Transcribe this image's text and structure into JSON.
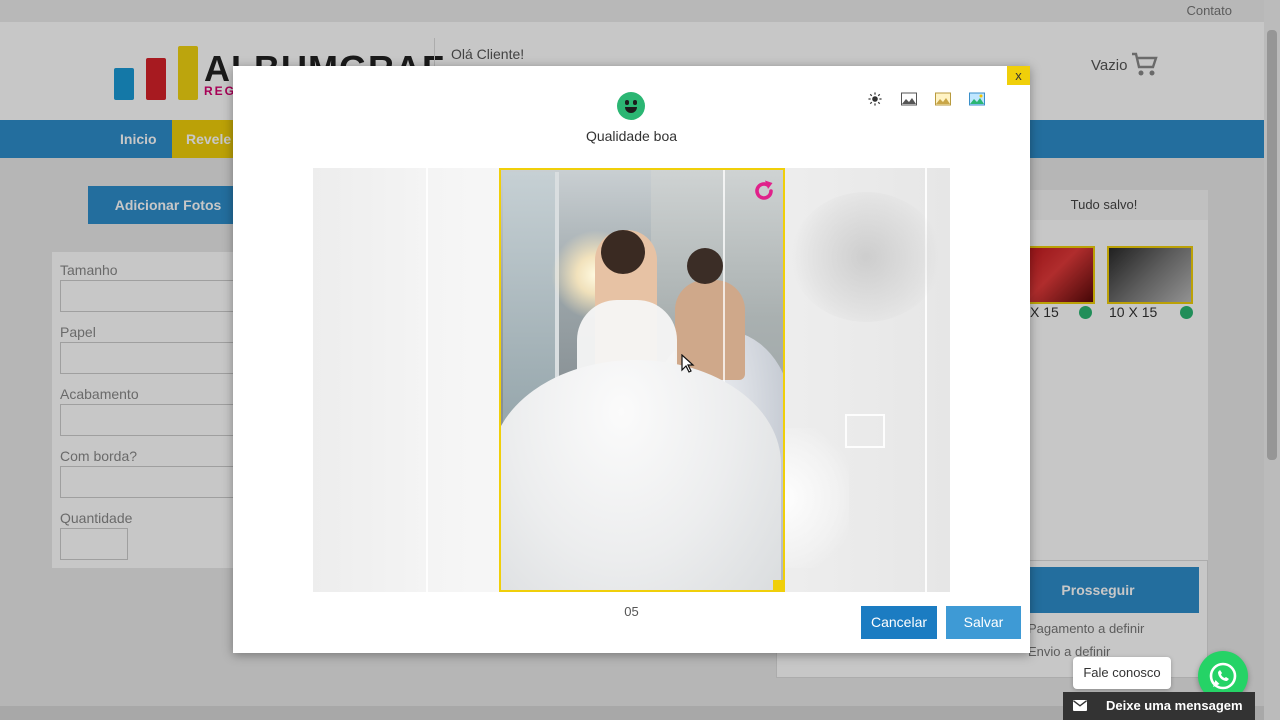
{
  "topbar": {
    "contact": "Contato"
  },
  "header": {
    "logo_text": "ALBUMGRAF",
    "logo_sub": "REGI",
    "greeting": "Olá Cliente!",
    "cart_label": "Vazio"
  },
  "nav": {
    "items": [
      {
        "label": "Inicio"
      },
      {
        "label": "Revele"
      }
    ]
  },
  "sidebar": {
    "add_photos": "Adicionar Fotos",
    "fields": [
      {
        "label": "Tamanho"
      },
      {
        "label": "Papel"
      },
      {
        "label": "Acabamento"
      },
      {
        "label": "Com borda?"
      },
      {
        "label": "Quantidade"
      }
    ]
  },
  "cart_panel": {
    "status": "Tudo salvo!",
    "thumbnails": [
      {
        "size": "X 15"
      },
      {
        "size": "10 X 15"
      }
    ],
    "proceed": "Prosseguir",
    "payment": "Pagamento a definir",
    "shipping": "Envio a definir"
  },
  "modal": {
    "close": "x",
    "quality_label": "Qualidade boa",
    "tools": [
      "brightness-icon",
      "image-icon",
      "image-sepia-icon",
      "image-color-icon"
    ],
    "photo_number": "05",
    "cancel": "Cancelar",
    "save": "Salvar"
  },
  "chat": {
    "fale_conosco": "Fale conosco",
    "leave_message": "Deixe uma mensagem"
  },
  "colors": {
    "primary_blue": "#2e8dcb",
    "accent_yellow": "#f0cf0a",
    "quality_green": "#2bb673",
    "rotate_pink": "#e0218a",
    "whatsapp_green": "#25d366"
  }
}
